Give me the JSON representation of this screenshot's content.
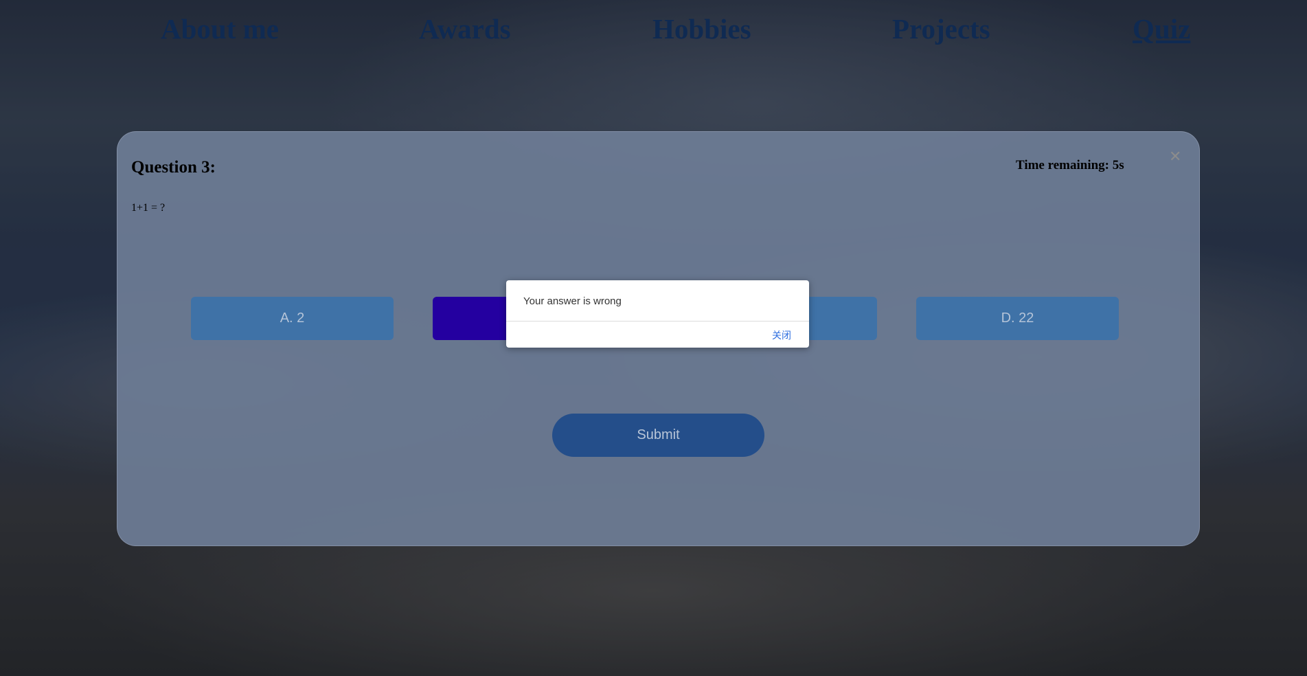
{
  "nav": {
    "items": [
      {
        "label": "About me",
        "active": false
      },
      {
        "label": "Awards",
        "active": false
      },
      {
        "label": "Hobbies",
        "active": false
      },
      {
        "label": "Projects",
        "active": false
      },
      {
        "label": "Quiz",
        "active": true
      }
    ]
  },
  "quiz": {
    "title": "Question 3:",
    "question": "1+1 = ?",
    "timer": "Time remaining: 5s",
    "close_icon": "close-icon",
    "options": [
      {
        "label": "A. 2",
        "selected": false
      },
      {
        "label": "",
        "selected": true
      },
      {
        "label": "",
        "selected": false
      },
      {
        "label": "D. 22",
        "selected": false
      }
    ],
    "submit_label": "Submit"
  },
  "alert": {
    "message": "Your answer is wrong",
    "close_label": "关闭"
  },
  "colors": {
    "nav_link": "#0f2a52",
    "option_bg": "#3f72a7",
    "option_selected_bg": "#2400a0",
    "submit_bg": "#244e8a",
    "alert_link": "#2f6fe0"
  }
}
